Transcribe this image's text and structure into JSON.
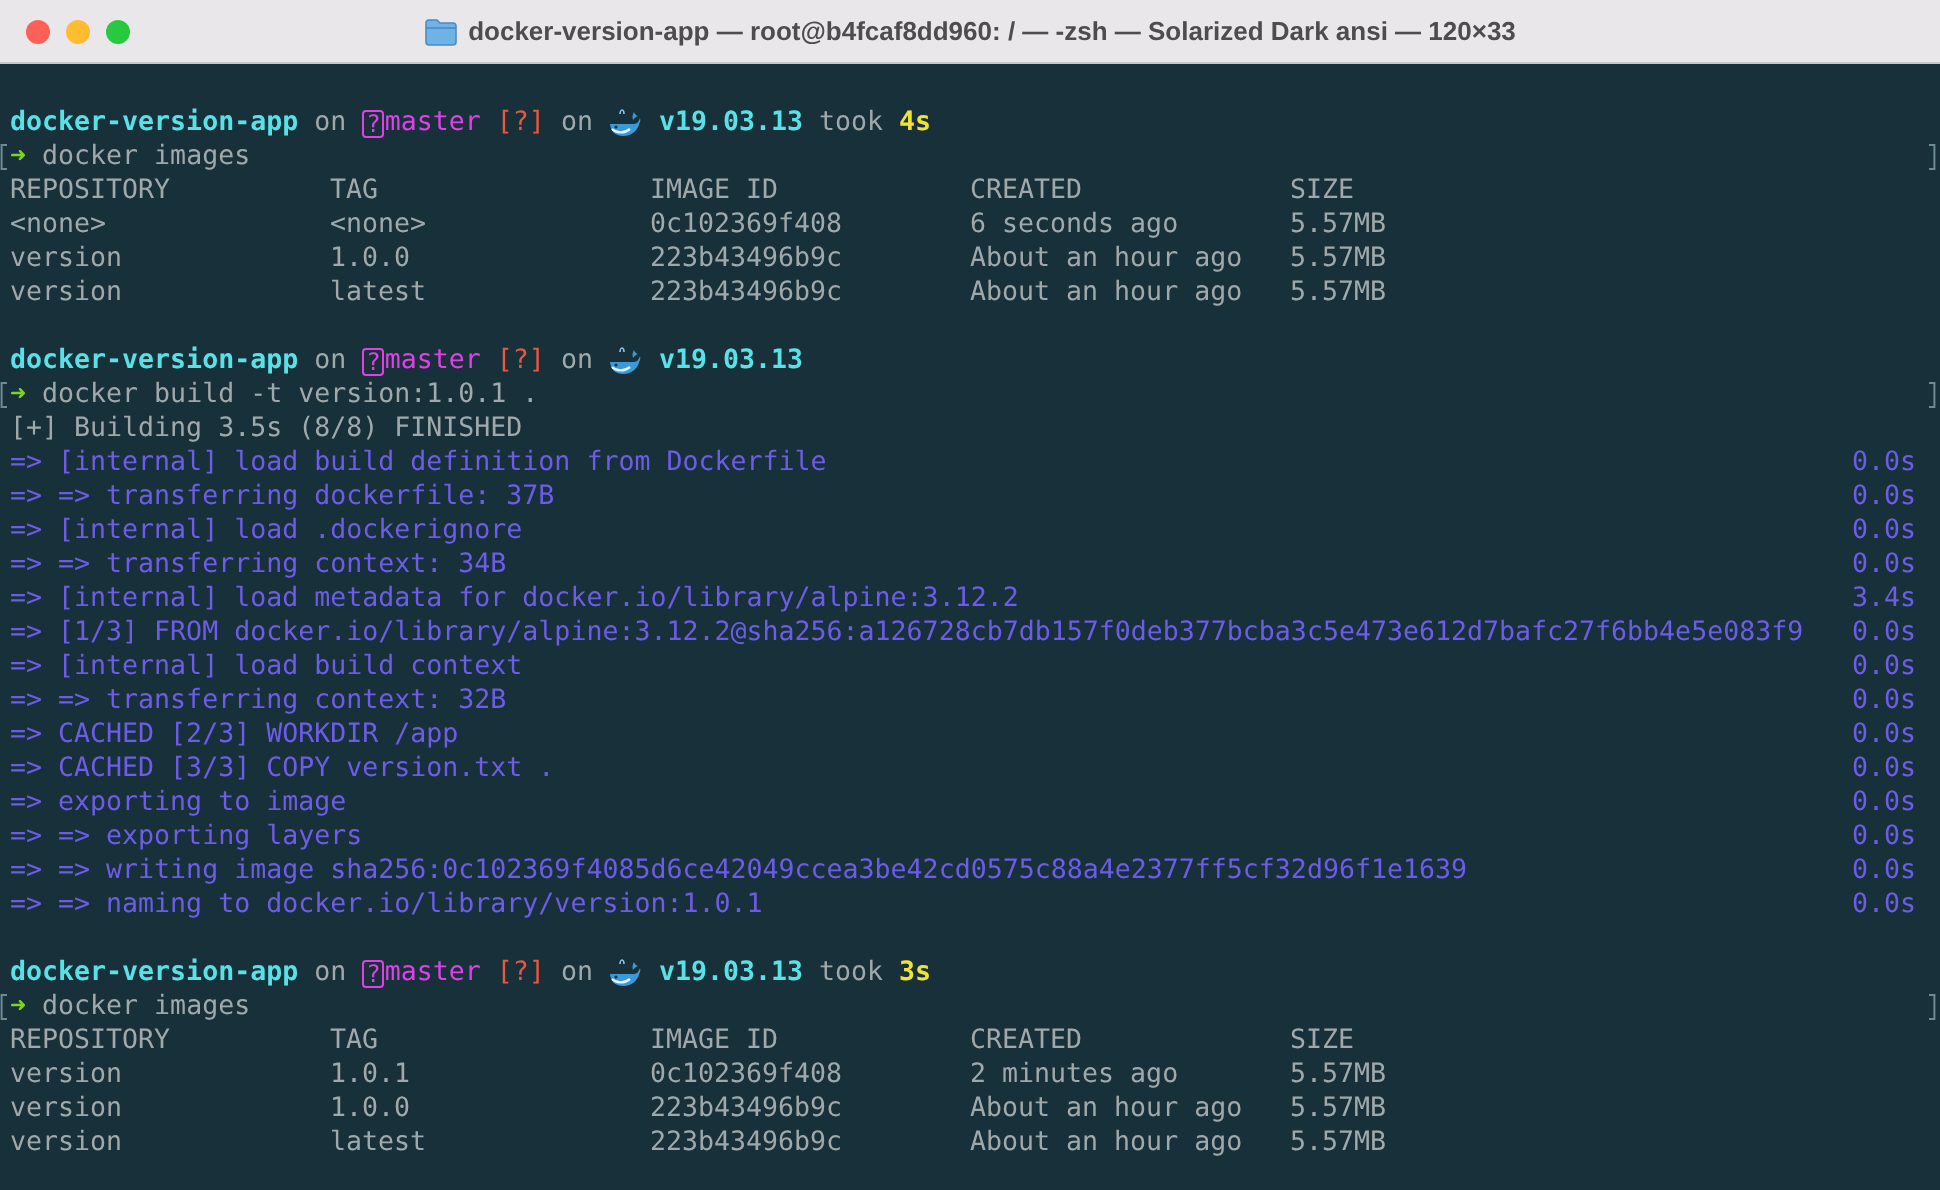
{
  "window": {
    "title": "docker-version-app — root@b4fcaf8dd960: / — -zsh — Solarized Dark ansi — 120×33"
  },
  "sessions": [
    {
      "prompt": {
        "directory": "docker-version-app",
        "on_1": "on",
        "branch_badge": "?",
        "branch": "master",
        "git_status": "[?]",
        "on_2": "on",
        "docker_version": "v19.03.13",
        "took": "took",
        "duration": "4s"
      },
      "command": {
        "arrow": "➜",
        "text": "docker images"
      },
      "output": [
        {
          "kind": "table",
          "columns": [
            "REPOSITORY",
            "TAG",
            "IMAGE ID",
            "CREATED",
            "SIZE"
          ],
          "rows": [
            [
              "<none>",
              "<none>",
              "0c102369f408",
              "6 seconds ago",
              "5.57MB"
            ],
            [
              "version",
              "1.0.0",
              "223b43496b9c",
              "About an hour ago",
              "5.57MB"
            ],
            [
              "version",
              "latest",
              "223b43496b9c",
              "About an hour ago",
              "5.57MB"
            ]
          ]
        }
      ]
    },
    {
      "prompt": {
        "directory": "docker-version-app",
        "on_1": "on",
        "branch_badge": "?",
        "branch": "master",
        "git_status": "[?]",
        "on_2": "on",
        "docker_version": "v19.03.13"
      },
      "command": {
        "arrow": "➜",
        "text": "docker build -t version:1.0.1 ."
      },
      "output": [
        {
          "kind": "line",
          "text": "[+] Building 3.5s (8/8) FINISHED"
        },
        {
          "kind": "step",
          "text": "=> [internal] load build definition from Dockerfile",
          "time": "0.0s"
        },
        {
          "kind": "step",
          "text": "=> => transferring dockerfile: 37B",
          "time": "0.0s"
        },
        {
          "kind": "step",
          "text": "=> [internal] load .dockerignore",
          "time": "0.0s"
        },
        {
          "kind": "step",
          "text": "=> => transferring context: 34B",
          "time": "0.0s"
        },
        {
          "kind": "step",
          "text": "=> [internal] load metadata for docker.io/library/alpine:3.12.2",
          "time": "3.4s"
        },
        {
          "kind": "step",
          "text": "=> [1/3] FROM docker.io/library/alpine:3.12.2@sha256:a126728cb7db157f0deb377bcba3c5e473e612d7bafc27f6bb4e5e083f9",
          "time": "0.0s"
        },
        {
          "kind": "step",
          "text": "=> [internal] load build context",
          "time": "0.0s"
        },
        {
          "kind": "step",
          "text": "=> => transferring context: 32B",
          "time": "0.0s"
        },
        {
          "kind": "step",
          "text": "=> CACHED [2/3] WORKDIR /app",
          "time": "0.0s"
        },
        {
          "kind": "step",
          "text": "=> CACHED [3/3] COPY version.txt .",
          "time": "0.0s"
        },
        {
          "kind": "step",
          "text": "=> exporting to image",
          "time": "0.0s"
        },
        {
          "kind": "step",
          "text": "=> => exporting layers",
          "time": "0.0s"
        },
        {
          "kind": "step",
          "text": "=> => writing image sha256:0c102369f4085d6ce42049ccea3be42cd0575c88a4e2377ff5cf32d96f1e1639",
          "time": "0.0s"
        },
        {
          "kind": "step",
          "text": "=> => naming to docker.io/library/version:1.0.1",
          "time": "0.0s"
        }
      ]
    },
    {
      "prompt": {
        "directory": "docker-version-app",
        "on_1": "on",
        "branch_badge": "?",
        "branch": "master",
        "git_status": "[?]",
        "on_2": "on",
        "docker_version": "v19.03.13",
        "took": "took",
        "duration": "3s"
      },
      "command": {
        "arrow": "➜",
        "text": "docker images"
      },
      "output": [
        {
          "kind": "table",
          "columns": [
            "REPOSITORY",
            "TAG",
            "IMAGE ID",
            "CREATED",
            "SIZE"
          ],
          "rows": [
            [
              "version",
              "1.0.1",
              "0c102369f408",
              "2 minutes ago",
              "5.57MB"
            ],
            [
              "version",
              "1.0.0",
              "223b43496b9c",
              "About an hour ago",
              "5.57MB"
            ],
            [
              "version",
              "latest",
              "223b43496b9c",
              "About an hour ago",
              "5.57MB"
            ]
          ]
        }
      ]
    }
  ]
}
